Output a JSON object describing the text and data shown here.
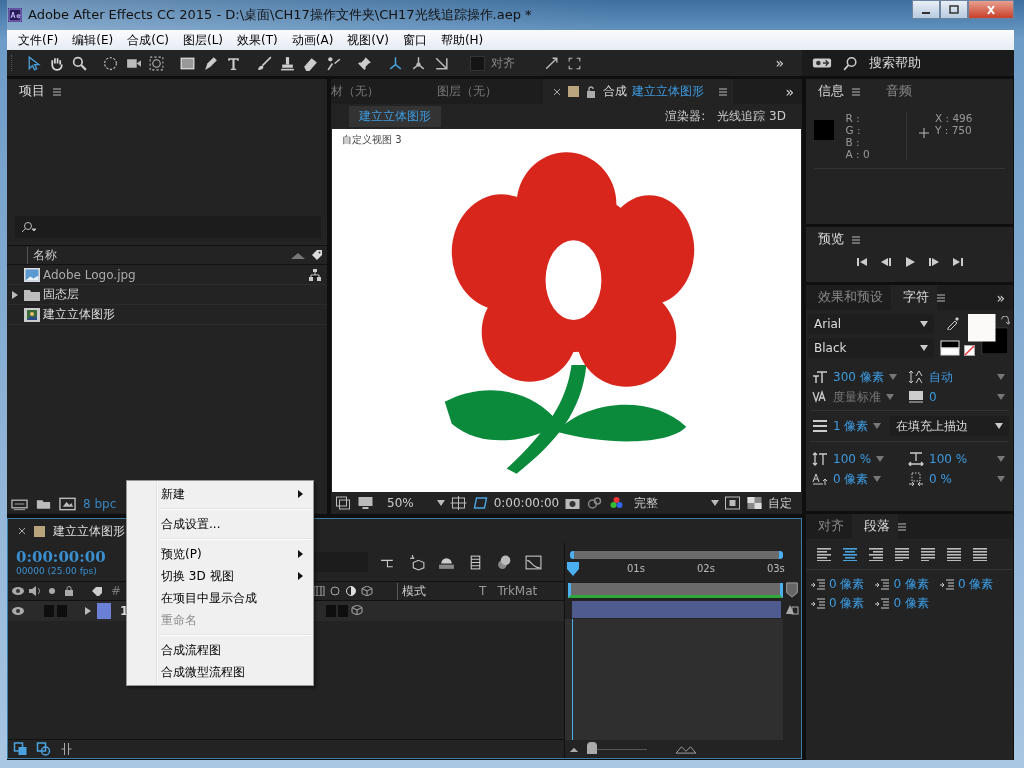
{
  "window": {
    "title": "Adobe After Effects CC 2015 - D:\\桌面\\CH17操作文件夹\\CH17光线追踪操作.aep *"
  },
  "menu_bar": [
    "文件(F)",
    "编辑(E)",
    "合成(C)",
    "图层(L)",
    "效果(T)",
    "动画(A)",
    "视图(V)",
    "窗口",
    "帮助(H)"
  ],
  "toolbar": {
    "snap": {
      "label": "对齐",
      "checked": false
    },
    "more": "»",
    "search_help": "搜索帮助"
  },
  "project_panel": {
    "title": "项目",
    "column_name": "名称",
    "items": [
      {
        "name": "Adobe Logo.jpg",
        "kind": "footage"
      },
      {
        "name": "固态层",
        "kind": "folder",
        "expanded": false
      },
      {
        "name": "建立立体图形",
        "kind": "composition"
      }
    ],
    "bit_depth": "8 bpc"
  },
  "viewer_tabs": [
    {
      "label": "材（无）",
      "selected": false
    },
    {
      "label": "图层（无）",
      "selected": false
    },
    {
      "prefix": "合成",
      "label": "建立立体图形",
      "selected": true
    }
  ],
  "viewer_more": "»",
  "viewer": {
    "comp_button": "建立立体图形",
    "renderer_label": "渲染器:",
    "renderer": "光线追踪 3D",
    "view_label": "自定义视图 3",
    "zoom": "50%",
    "time": "0:00:00:00",
    "resolution": "完整",
    "view": "自定"
  },
  "timeline": {
    "tab": "建立立体图形",
    "timecode": "0:00:00:00",
    "fps": "00000 (25.00 fps)",
    "columns": [
      "#",
      "模式",
      "T",
      "TrkMat"
    ],
    "layers": [
      {
        "number": "1",
        "color": "#6b7fd6",
        "visible": true
      }
    ],
    "ruler": [
      "01s",
      "02s",
      "03s"
    ]
  },
  "context_menu": {
    "groups": [
      {
        "items": [
          {
            "label": "新建",
            "submenu": true,
            "disabled": false
          }
        ]
      },
      {
        "items": [
          {
            "label": "合成设置...",
            "submenu": false,
            "disabled": false
          }
        ]
      },
      {
        "items": [
          {
            "label": "预览(P)",
            "submenu": true,
            "disabled": false
          },
          {
            "label": "切换 3D 视图",
            "submenu": true,
            "disabled": false
          },
          {
            "label": "在项目中显示合成",
            "submenu": false,
            "disabled": false
          },
          {
            "label": "重命名",
            "submenu": false,
            "disabled": true
          }
        ]
      },
      {
        "items": [
          {
            "label": "合成流程图",
            "submenu": false,
            "disabled": false
          },
          {
            "label": "合成微型流程图",
            "submenu": false,
            "disabled": false
          }
        ]
      }
    ]
  },
  "info_panel": {
    "tabs": [
      {
        "label": "信息",
        "selected": true
      },
      {
        "label": "音频",
        "selected": false
      }
    ],
    "channels": [
      "R :",
      "G :",
      "B :",
      "A : 0"
    ],
    "coords": [
      "X : 496",
      "Y : 750"
    ]
  },
  "preview_panel": {
    "title": "预览"
  },
  "character_panel": {
    "tabs": [
      {
        "label": "效果和预设",
        "selected": false
      },
      {
        "label": "字符",
        "selected": true
      }
    ],
    "more": "»",
    "font": "Arial",
    "style": "Black",
    "size": "300 像素",
    "leading": "自动",
    "kerning": "度量标准",
    "tracking": "0",
    "stroke_width": "1 像素",
    "stroke_mode": "在填充上描边",
    "vertical_scale": "100 %",
    "horizontal_scale": "100 %",
    "baseline_shift": "0 像素",
    "tsume": "0 %"
  },
  "paragraph_panel": {
    "tabs": [
      {
        "label": "对齐",
        "selected": false
      },
      {
        "label": "段落",
        "selected": true
      }
    ],
    "alignments": [
      {
        "selected": false
      },
      {
        "selected": true
      },
      {
        "selected": false
      },
      {
        "selected": false
      },
      {
        "selected": false
      },
      {
        "selected": false
      },
      {
        "selected": false
      }
    ],
    "indents": [
      "0 像素",
      "0 像素",
      "0 像素",
      "0 像素",
      "0 像素"
    ]
  }
}
